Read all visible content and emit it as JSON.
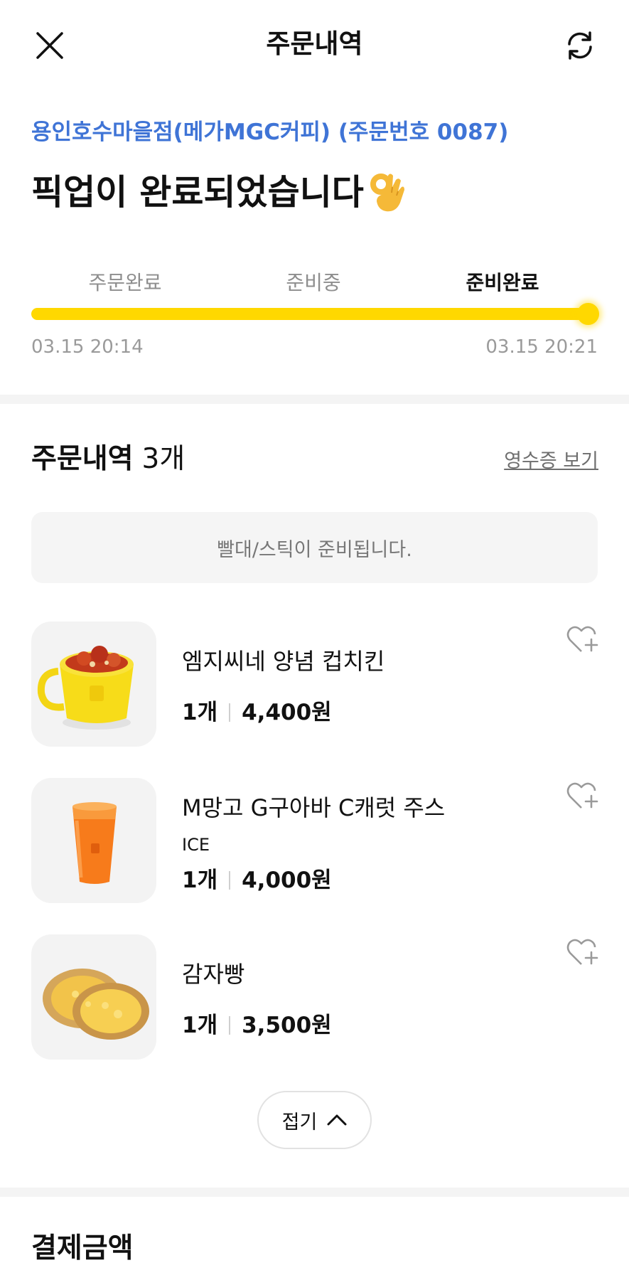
{
  "header": {
    "title": "주문내역",
    "close_icon": "close-icon",
    "refresh_icon": "refresh-icon"
  },
  "store": {
    "name_line": "용인호수마을점(메가MGC커피) (주문번호 0087)"
  },
  "status": {
    "title": "픽업이 완료되었습니다",
    "emoji_icon": "ok-hand-emoji"
  },
  "progress": {
    "steps": [
      "주문완료",
      "준비중",
      "준비완료"
    ],
    "active_step": 2,
    "level": 1.0,
    "start_time": "03.15 20:14",
    "end_time": "03.15 20:21",
    "color": "#ffd800"
  },
  "order": {
    "section_title": "주문내역",
    "count_label": "3개",
    "receipt_link": "영수증 보기",
    "notice": "빨대/스틱이 준비됩니다.",
    "items": [
      {
        "name": "엠지씨네 양념 컵치킨",
        "option": "",
        "qty": "1개",
        "price": "4,400원",
        "image": "cup-chicken-image"
      },
      {
        "name": "M망고 G구아바 C캐럿 주스",
        "option": "ICE",
        "qty": "1개",
        "price": "4,000원",
        "image": "mango-juice-image"
      },
      {
        "name": "감자빵",
        "option": "",
        "qty": "1개",
        "price": "3,500원",
        "image": "potato-bread-image"
      }
    ],
    "collapse_label": "접기"
  },
  "payment": {
    "title": "결제금액"
  },
  "colors": {
    "accent_blue": "#3f74d6",
    "progress_yellow": "#ffd800"
  }
}
